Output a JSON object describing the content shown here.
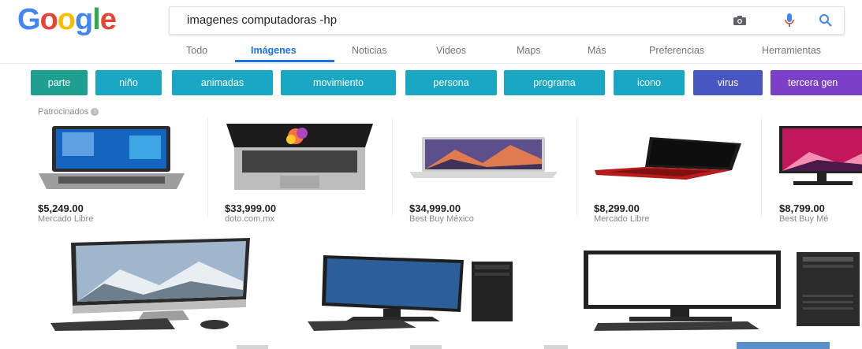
{
  "logo": {
    "letters": [
      "G",
      "o",
      "o",
      "g",
      "l",
      "e"
    ],
    "colors": [
      "#4285f4",
      "#ea4335",
      "#fbbc05",
      "#4285f4",
      "#34a853",
      "#ea4335"
    ]
  },
  "search": {
    "query": "imagenes computadoras -hp",
    "icons": [
      "camera-icon",
      "microphone-icon",
      "search-icon"
    ]
  },
  "tabs": [
    "Todo",
    "Imágenes",
    "Noticias",
    "Videos",
    "Maps",
    "Más",
    "Preferencias",
    "Herramientas"
  ],
  "active_tab": "Imágenes",
  "chips": [
    {
      "label": "parte",
      "color": "#1e9f8f"
    },
    {
      "label": "niño",
      "color": "#1aa7c4"
    },
    {
      "label": "animadas",
      "color": "#1aa7c4"
    },
    {
      "label": "movimiento",
      "color": "#1aa7c4"
    },
    {
      "label": "persona",
      "color": "#1aa7c4"
    },
    {
      "label": "programa",
      "color": "#1aa7c4"
    },
    {
      "label": "icono",
      "color": "#1aa7c4"
    },
    {
      "label": "virus",
      "color": "#4a55c4"
    },
    {
      "label": "tercera gen",
      "color": "#7b3fc8"
    }
  ],
  "sponsored_label": "Patrocinados",
  "products": [
    {
      "price": "$5,249.00",
      "store": "Mercado Libre"
    },
    {
      "price": "$33,999.00",
      "store": "doto.com.mx"
    },
    {
      "price": "$34,999.00",
      "store": "Best Buy México"
    },
    {
      "price": "$8,299.00",
      "store": "Mercado Libre"
    },
    {
      "price": "$8,799.00",
      "store": "Best Buy Mé"
    }
  ]
}
